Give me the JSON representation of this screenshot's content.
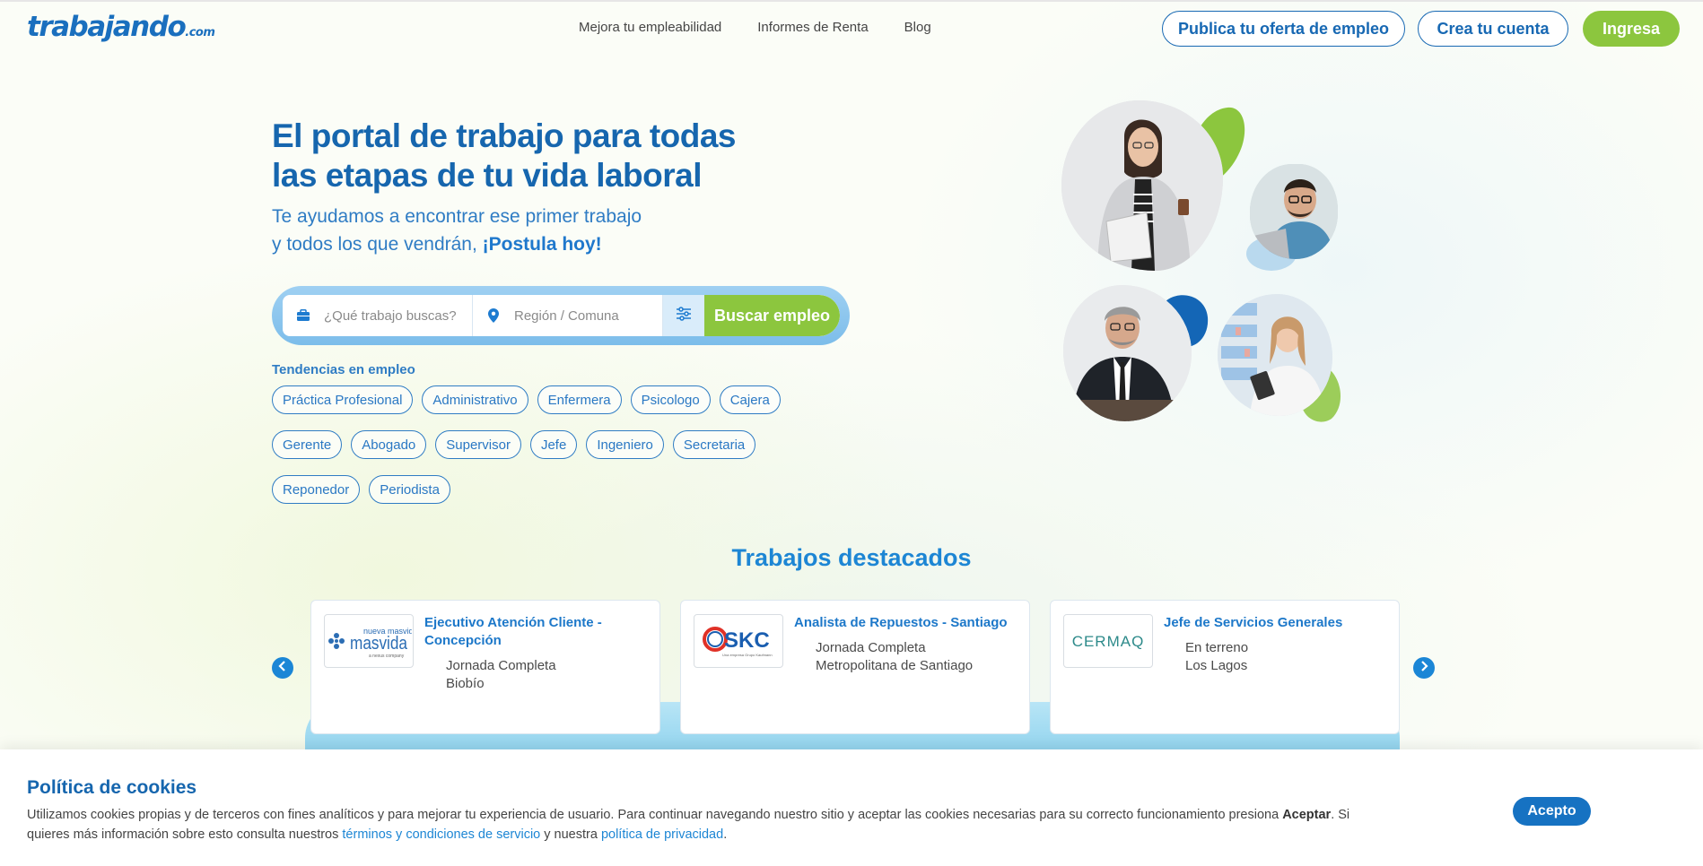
{
  "header": {
    "logo_main": "trabajando",
    "logo_domain": ".com",
    "nav": [
      "Mejora tu empleabilidad",
      "Informes de Renta",
      "Blog"
    ],
    "publish_label": "Publica tu oferta de empleo",
    "create_label": "Crea tu cuenta",
    "login_label": "Ingresa"
  },
  "hero": {
    "title_line1": "El portal de trabajo para todas",
    "title_line2": "las etapas de tu vida laboral",
    "subtitle_line1": "Te ayudamos a encontrar ese primer trabajo",
    "subtitle_line2": "y todos los que vendrán,",
    "subtitle_cta": "¡Postula hoy!"
  },
  "search": {
    "job_placeholder": "¿Qué trabajo buscas?",
    "region_placeholder": "Región / Comuna",
    "button_label": "Buscar empleo"
  },
  "trends": {
    "label": "Tendencias en empleo",
    "chips": [
      "Práctica Profesional",
      "Administrativo",
      "Enfermera",
      "Psicologo",
      "Cajera",
      "Gerente",
      "Abogado",
      "Supervisor",
      "Jefe",
      "Ingeniero",
      "Secretaria",
      "Reponedor",
      "Periodista"
    ]
  },
  "featured": {
    "title": "Trabajos destacados",
    "jobs": [
      {
        "company": "nueva masvida",
        "company_tagline": "a nexus company",
        "title": "Ejecutivo Atención Cliente - Concepción",
        "detail1": "Jornada Completa",
        "detail2": "Biobío"
      },
      {
        "company": "SKC",
        "company_tagline": "Una empresa Grupo Kaufmann",
        "title": "Analista de Repuestos - Santiago",
        "detail1": "Jornada Completa",
        "detail2": "Metropolitana de Santiago"
      },
      {
        "company": "CERMAQ",
        "title": "Jefe de Servicios Generales",
        "detail1": "En terreno",
        "detail2": "Los Lagos"
      }
    ]
  },
  "cookies": {
    "title": "Política de cookies",
    "text_part1": "Utilizamos cookies propias y de terceros con fines analíticos y para mejorar tu experiencia de usuario. Para continuar navegando nuestro sitio y aceptar las cookies necesarias para su correcto funcionamiento presiona",
    "text_bold": "Aceptar",
    "text_part2": ". Si quieres más información sobre esto consulta nuestros",
    "link_terms": "términos y condiciones de servicio",
    "text_part3": "y nuestra",
    "link_privacy": "política de privacidad",
    "text_end": ".",
    "accept_label": "Acepto"
  },
  "colors": {
    "brand_blue": "#1666ae",
    "brand_green": "#8cc63e",
    "link_blue": "#1d86d4"
  }
}
